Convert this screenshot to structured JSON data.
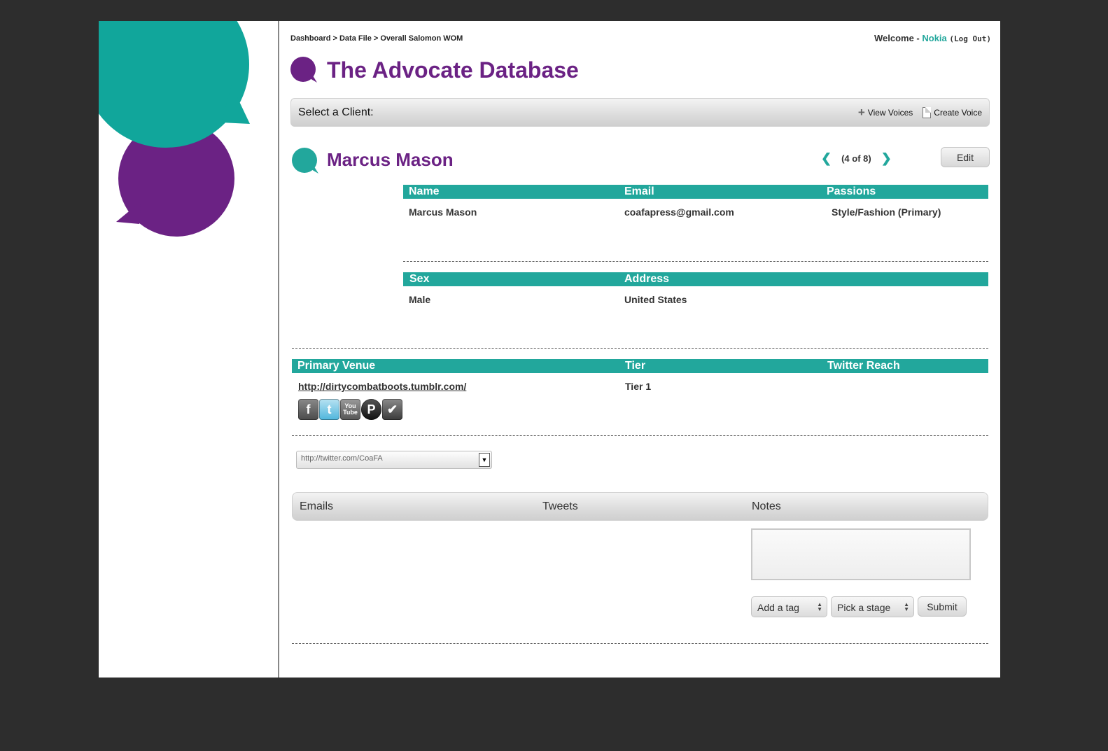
{
  "breadcrumb": "Dashboard > Data File > Overall Salomon WOM",
  "welcome": {
    "prefix": "Welcome - ",
    "user": "Nokia",
    "logout": "(Log Out)"
  },
  "app_title": "The Advocate Database",
  "toolbar": {
    "select_client": "Select a Client:",
    "view_voices": "View Voices",
    "create_voice": "Create Voice"
  },
  "person": {
    "name": "Marcus Mason",
    "pager": "(4 of 8)",
    "edit": "Edit"
  },
  "section1": {
    "headers": {
      "name": "Name",
      "email": "Email",
      "passions": "Passions"
    },
    "values": {
      "name": "Marcus Mason",
      "email": "coafapress@gmail.com",
      "passions": "Style/Fashion (Primary)"
    }
  },
  "section2": {
    "headers": {
      "sex": "Sex",
      "address": "Address"
    },
    "values": {
      "sex": "Male",
      "address": "United States"
    }
  },
  "section3": {
    "headers": {
      "venue": "Primary Venue",
      "tier": "Tier",
      "reach": "Twitter Reach"
    },
    "values": {
      "venue": "http://dirtycombatboots.tumblr.com/",
      "tier": "Tier 1",
      "reach": ""
    }
  },
  "social_icons": [
    "facebook-icon",
    "twitter-icon",
    "youtube-icon",
    "pinterest-icon",
    "foursquare-icon"
  ],
  "social_glyphs": {
    "facebook": "f",
    "twitter": "t",
    "youtube": "You\nTube",
    "pinterest": "P",
    "foursquare": "✔"
  },
  "url_select": {
    "value": "http://twitter.com/CoaFA"
  },
  "tabs": {
    "emails": "Emails",
    "tweets": "Tweets",
    "notes": "Notes"
  },
  "notes_form": {
    "tag_placeholder": "Add a tag",
    "stage_placeholder": "Pick a stage",
    "submit": "Submit"
  },
  "colors": {
    "teal": "#22a79c",
    "purple": "#6b2284"
  }
}
